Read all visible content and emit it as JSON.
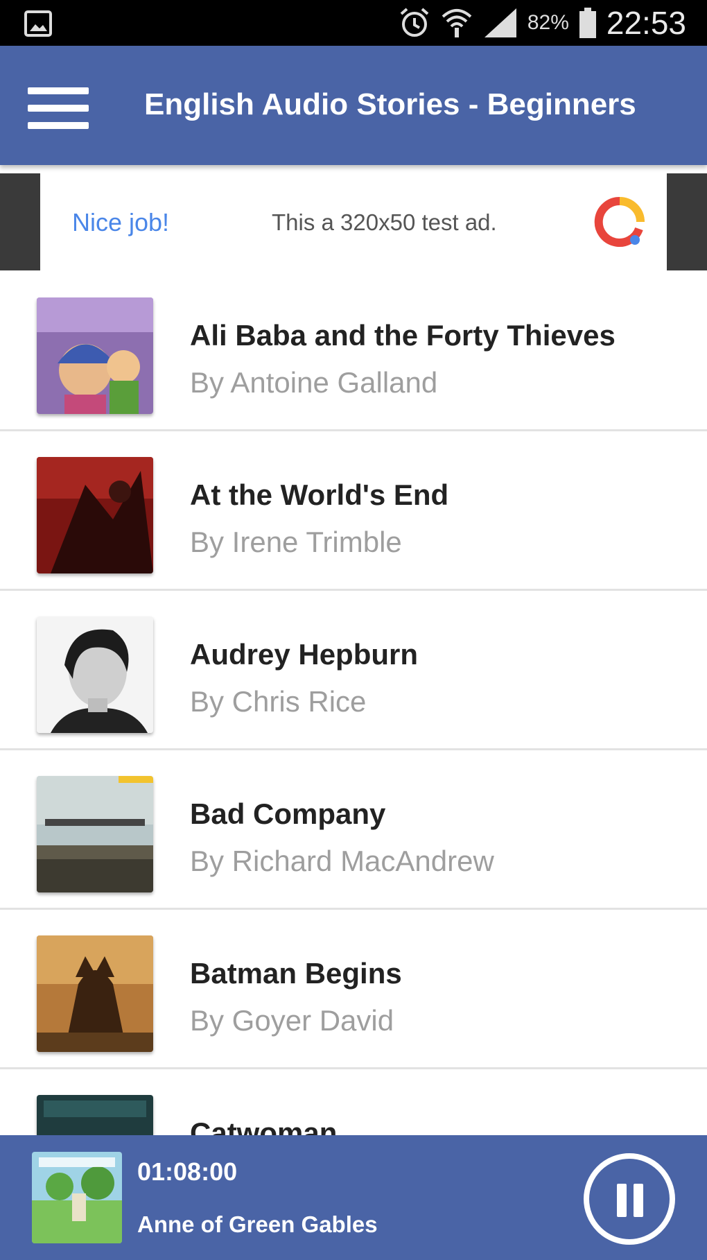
{
  "status_bar": {
    "battery": "82%",
    "time": "22:53",
    "icons": [
      "image-icon",
      "alarm-icon",
      "wifi-icon",
      "signal-icon",
      "battery-icon"
    ]
  },
  "app_bar": {
    "title": "English Audio Stories - Beginners",
    "menu_icon": "hamburger-menu-icon",
    "color": "#4a64a6"
  },
  "ad": {
    "nice_label": "Nice job!",
    "text": "This a 320x50 test ad."
  },
  "stories": [
    {
      "title": "Ali Baba and the Forty Thieves",
      "author": "By Antoine Galland"
    },
    {
      "title": "At the World's End",
      "author": "By Irene Trimble"
    },
    {
      "title": "Audrey Hepburn",
      "author": "By Chris Rice"
    },
    {
      "title": "Bad Company",
      "author": "By Richard MacAndrew"
    },
    {
      "title": "Batman Begins",
      "author": "By Goyer David"
    },
    {
      "title": "Catwoman",
      "author": ""
    }
  ],
  "player": {
    "time": "01:08:00",
    "title": "Anne of Green Gables",
    "pause_icon": "pause-icon"
  }
}
